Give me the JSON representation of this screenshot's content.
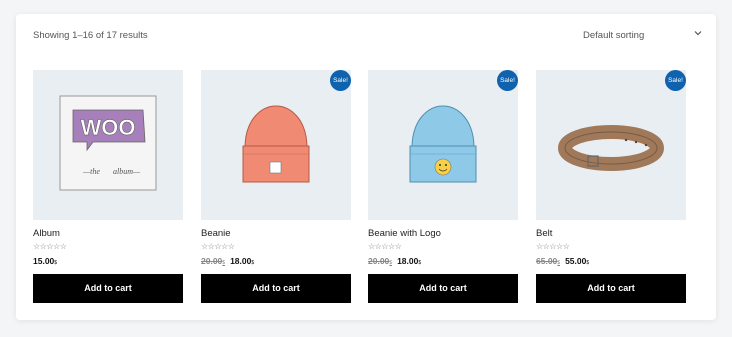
{
  "header": {
    "results_text": "Showing 1–16 of 17 results",
    "sorting_value": "Default sorting"
  },
  "products": [
    {
      "title": "Album",
      "stars": "☆☆☆☆☆",
      "old_price": "",
      "price": "15.00",
      "currency": "$",
      "sale_badge": "",
      "button": "Add to cart",
      "image_icon": "album-icon"
    },
    {
      "title": "Beanie",
      "stars": "☆☆☆☆☆",
      "old_price": "20.00",
      "price": "18.00",
      "currency": "$",
      "sale_badge": "Sale!",
      "button": "Add to cart",
      "image_icon": "beanie-icon"
    },
    {
      "title": "Beanie with Logo",
      "stars": "☆☆☆☆☆",
      "old_price": "20.00",
      "price": "18.00",
      "currency": "$",
      "sale_badge": "Sale!",
      "button": "Add to cart",
      "image_icon": "beanie-logo-icon"
    },
    {
      "title": "Belt",
      "stars": "☆☆☆☆☆",
      "old_price": "65.00",
      "price": "55.00",
      "currency": "$",
      "sale_badge": "Sale!",
      "button": "Add to cart",
      "image_icon": "belt-icon"
    }
  ],
  "colors": {
    "accent": "#0f62ae",
    "button": "#000000",
    "image_bg": "#e9eef2"
  }
}
